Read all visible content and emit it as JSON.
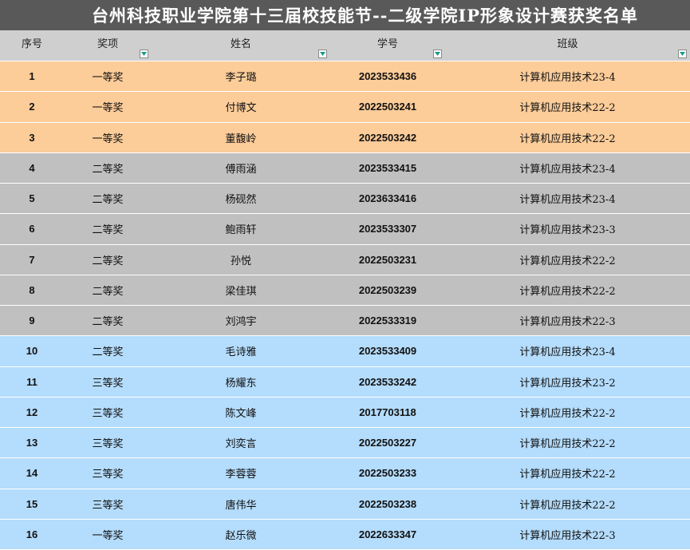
{
  "title": "台州科技职业学院第十三届校技能节--二级学院IP形象设计赛获奖名单",
  "columns": [
    {
      "key": "seq",
      "label": "序号",
      "filter": false
    },
    {
      "key": "award",
      "label": "奖项",
      "filter": true
    },
    {
      "key": "name",
      "label": "姓名",
      "filter": true
    },
    {
      "key": "student_id",
      "label": "学号",
      "filter": true
    },
    {
      "key": "class",
      "label": "班级",
      "filter": true
    }
  ],
  "colors": {
    "first_prize_row": "#fccc99",
    "second_prize_row": "#c0c0c0",
    "third_prize_row": "#b4dcfc",
    "title_bar": "#595959",
    "header": "#cfcfcf"
  },
  "rows": [
    {
      "seq": "1",
      "award": "一等奖",
      "name": "李子璐",
      "student_id": "2023533436",
      "class": "计算机应用技术23-4",
      "tier": 1
    },
    {
      "seq": "2",
      "award": "一等奖",
      "name": "付博文",
      "student_id": "2022503241",
      "class": "计算机应用技术22-2",
      "tier": 1
    },
    {
      "seq": "3",
      "award": "一等奖",
      "name": "董馥岭",
      "student_id": "2022503242",
      "class": "计算机应用技术22-2",
      "tier": 1
    },
    {
      "seq": "4",
      "award": "二等奖",
      "name": "傅雨涵",
      "student_id": "2023533415",
      "class": "计算机应用技术23-4",
      "tier": 2
    },
    {
      "seq": "5",
      "award": "二等奖",
      "name": "杨砚然",
      "student_id": "2023633416",
      "class": "计算机应用技术23-4",
      "tier": 2
    },
    {
      "seq": "6",
      "award": "二等奖",
      "name": "鲍雨轩",
      "student_id": "2023533307",
      "class": "计算机应用技术23-3",
      "tier": 2
    },
    {
      "seq": "7",
      "award": "二等奖",
      "name": "孙悦",
      "student_id": "2022503231",
      "class": "计算机应用技术22-2",
      "tier": 2
    },
    {
      "seq": "8",
      "award": "二等奖",
      "name": "梁佳琪",
      "student_id": "2022503239",
      "class": "计算机应用技术22-2",
      "tier": 2
    },
    {
      "seq": "9",
      "award": "二等奖",
      "name": "刘鸿宇",
      "student_id": "2022533319",
      "class": "计算机应用技术22-3",
      "tier": 2
    },
    {
      "seq": "10",
      "award": "二等奖",
      "name": "毛诗雅",
      "student_id": "2023533409",
      "class": "计算机应用技术23-4",
      "tier": 3
    },
    {
      "seq": "11",
      "award": "三等奖",
      "name": "杨耀东",
      "student_id": "2023533242",
      "class": "计算机应用技术23-2",
      "tier": 3
    },
    {
      "seq": "12",
      "award": "三等奖",
      "name": "陈文峰",
      "student_id": "2017703118",
      "class": "计算机应用技术22-2",
      "tier": 3
    },
    {
      "seq": "13",
      "award": "三等奖",
      "name": "刘奕言",
      "student_id": "2022503227",
      "class": "计算机应用技术22-2",
      "tier": 3
    },
    {
      "seq": "14",
      "award": "三等奖",
      "name": "李蓉蓉",
      "student_id": "2022503233",
      "class": "计算机应用技术22-2",
      "tier": 3
    },
    {
      "seq": "15",
      "award": "三等奖",
      "name": "唐伟华",
      "student_id": "2022503238",
      "class": "计算机应用技术22-2",
      "tier": 3
    },
    {
      "seq": "16",
      "award": "一等奖",
      "name": "赵乐微",
      "student_id": "2022633347",
      "class": "计算机应用技术22-3",
      "tier": 3
    }
  ]
}
